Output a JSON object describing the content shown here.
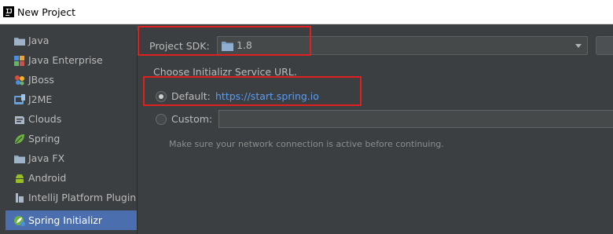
{
  "window": {
    "app_icon_text": "IJ",
    "title": "New Project"
  },
  "sidebar": {
    "items": [
      {
        "label": "Java",
        "icon": "java-folder-icon"
      },
      {
        "label": "Java Enterprise",
        "icon": "java-enterprise-icon"
      },
      {
        "label": "JBoss",
        "icon": "jboss-icon"
      },
      {
        "label": "J2ME",
        "icon": "j2me-icon"
      },
      {
        "label": "Clouds",
        "icon": "clouds-icon"
      },
      {
        "label": "Spring",
        "icon": "spring-leaf-icon"
      },
      {
        "label": "Java FX",
        "icon": "javafx-folder-icon"
      },
      {
        "label": "Android",
        "icon": "android-icon"
      },
      {
        "label": "IntelliJ Platform Plugin",
        "icon": "intellij-plugin-icon"
      },
      {
        "label": "Spring Initializr",
        "icon": "spring-initializr-icon",
        "selected": true
      }
    ]
  },
  "main": {
    "sdk_label": "Project SDK:",
    "sdk_value": "1.8",
    "choose_label": "Choose Initializr Service URL.",
    "default_label": "Default:",
    "default_url": "https://start.spring.io",
    "custom_label": "Custom:",
    "custom_value": "",
    "hint": "Make sure your network connection is active before continuing."
  },
  "colors": {
    "background": "#3c3f41",
    "selection": "#4b6eaf",
    "link": "#589df6",
    "annotation_red": "#e0201f"
  }
}
